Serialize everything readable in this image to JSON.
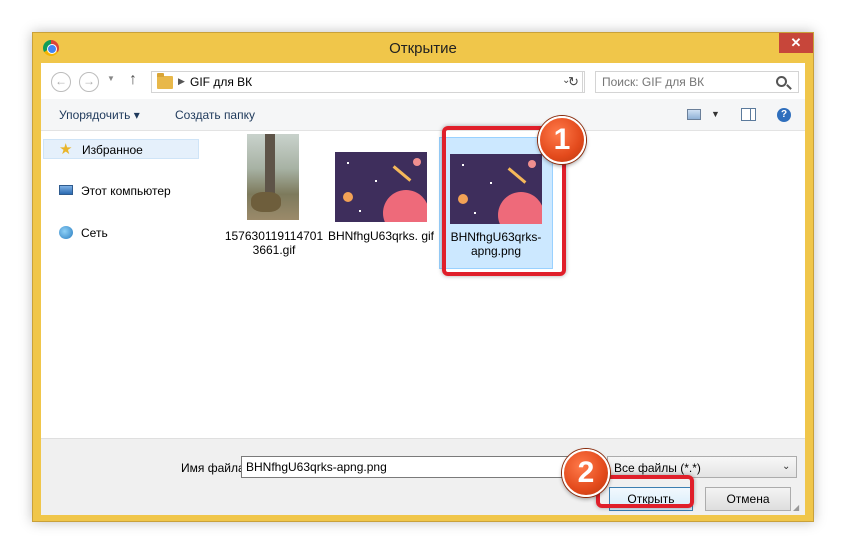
{
  "window": {
    "title": "Открытие",
    "close_glyph": "✕"
  },
  "nav": {
    "back_glyph": "←",
    "forward_glyph": "→",
    "recent_glyph": "▼",
    "up_glyph": "↑",
    "breadcrumb_sep": "▶",
    "breadcrumb": "GIF для ВК",
    "address_dropdown_glyph": "⌄",
    "refresh_glyph": "↻",
    "search_placeholder": "Поиск: GIF для ВК"
  },
  "toolbar": {
    "organize": "Упорядочить ▾",
    "new_folder": "Создать папку",
    "view_dropdown_glyph": "▼",
    "help_glyph": "?"
  },
  "sidebar": {
    "items": [
      {
        "label": "Избранное",
        "icon": "star-icon"
      },
      {
        "label": "Этот компьютер",
        "icon": "computer-icon"
      },
      {
        "label": "Сеть",
        "icon": "network-icon"
      }
    ]
  },
  "files": [
    {
      "name": "1576301191147013661.gif",
      "display": "157630119114701 3661.gif",
      "selected": false
    },
    {
      "name": "BHNfhgU63qrks.gif",
      "display": "BHNfhgU63qrks. gif",
      "selected": false
    },
    {
      "name": "BHNfhgU63qrks-apng.png",
      "display": "BHNfhgU63qrks- apng.png",
      "selected": true
    }
  ],
  "bottom": {
    "filename_label": "Имя файла:",
    "filename_value": "BHNfhgU63qrks-apng.png",
    "filter": "Все файлы (*.*)",
    "filter_dropdown_glyph": "⌄",
    "open": "Открыть",
    "cancel": "Отмена"
  },
  "annotations": {
    "step1": "1",
    "step2": "2"
  },
  "colors": {
    "titlebar": "#f0c64a",
    "close_button": "#c7463a",
    "selection": "#cce8ff",
    "annotation_red": "#e01f2a",
    "badge_orange": "#e34a1c"
  }
}
